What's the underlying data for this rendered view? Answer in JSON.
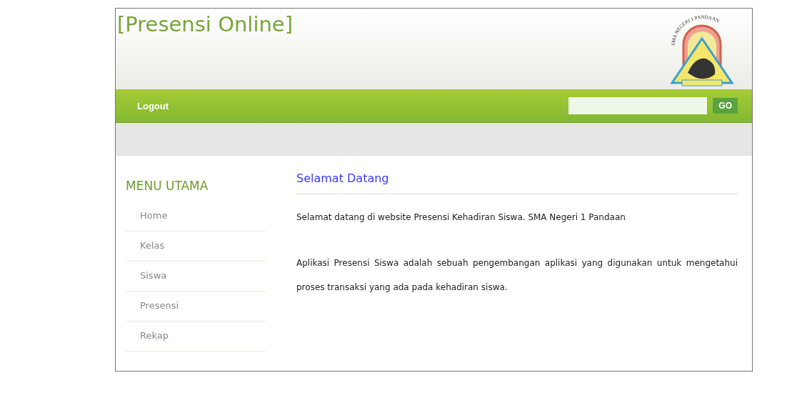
{
  "header": {
    "title": "[Presensi Online]",
    "logo_text": "SMA NEGERI 1 PANDAAN"
  },
  "navbar": {
    "links": [
      "Logout"
    ],
    "search": {
      "button": "GO"
    }
  },
  "sidebar": {
    "title": "MENU UTAMA",
    "items": [
      "Home",
      "Kelas",
      "Siswa",
      "Presensi",
      "Rekap"
    ]
  },
  "content": {
    "heading": "Selamat Datang",
    "paragraphs": [
      "Selamat datang di website Presensi Kehadiran Siswa. SMA Negeri 1 Pandaan",
      "Aplikasi Presensi Siswa adalah sebuah pengembangan aplikasi yang digunakan untuk mengetahui proses transaksi yang ada pada kehadiran siswa."
    ]
  }
}
